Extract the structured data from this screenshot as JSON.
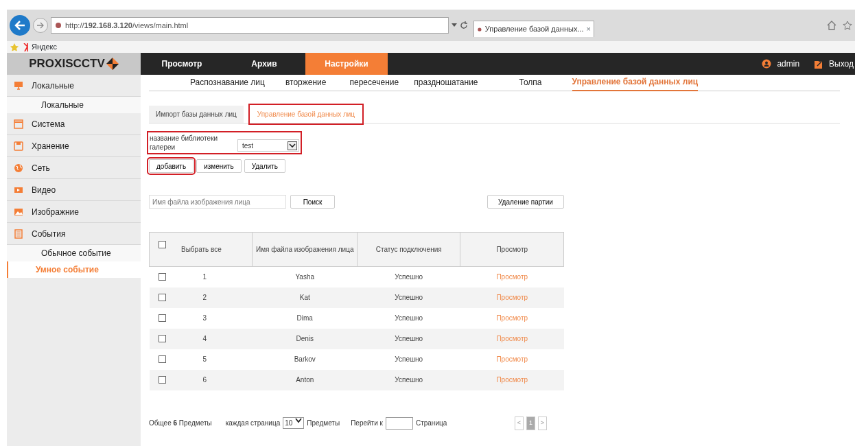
{
  "browser": {
    "url": "http://**192.168.3.120**/views/main.html",
    "tab_title": "Управление базой данных...",
    "tab_close": "×",
    "favorites": [
      "Яндекс"
    ]
  },
  "header": {
    "logo": "PROXISCCTV",
    "nav": [
      {
        "label": "Просмотр",
        "selected": false
      },
      {
        "label": "Архив",
        "selected": false
      },
      {
        "label": "Настройки",
        "selected": true
      }
    ],
    "user": "admin",
    "logout": "Выход"
  },
  "sidebar": {
    "items": [
      {
        "label": "Локальные",
        "children": [
          {
            "label": "Локальные",
            "selected": false
          }
        ]
      },
      {
        "label": "Система"
      },
      {
        "label": "Хранение"
      },
      {
        "label": "Сеть"
      },
      {
        "label": "Видео"
      },
      {
        "label": "Изображние"
      },
      {
        "label": "События",
        "children": [
          {
            "label": "Обычное событие",
            "selected": false
          },
          {
            "label": "Умное событие",
            "selected": true
          }
        ]
      }
    ]
  },
  "subtabs": [
    {
      "label": "Распознавание лиц",
      "selected": false
    },
    {
      "label": "вторжение",
      "selected": false
    },
    {
      "label": "пересечение",
      "selected": false
    },
    {
      "label": "праздношатание",
      "selected": false
    },
    {
      "label": "Толпа",
      "selected": false
    },
    {
      "label": "Управление базой данных лиц",
      "selected": true
    }
  ],
  "inner_tabs": [
    {
      "label": "Импорт базы данных лиц",
      "selected": false,
      "highlighted": false
    },
    {
      "label": "Управление базой данных лиц",
      "selected": true,
      "highlighted": true
    }
  ],
  "gallery": {
    "label": "название библиотеки галереи",
    "value": "test",
    "highlighted": true
  },
  "actions": [
    {
      "label": "добавить",
      "highlighted": true
    },
    {
      "label": "изменить",
      "highlighted": false
    },
    {
      "label": "Удалить",
      "highlighted": false
    }
  ],
  "search": {
    "placeholder": "Имя файла изображения лица",
    "button": "Поиск",
    "batch_delete": "Удаление партии"
  },
  "table": {
    "select_all": {
      "label": "Выбрать все",
      "checked": false
    },
    "columns": [
      "Имя файла изображения лица",
      "Статус подключения",
      "Просмотр"
    ],
    "rows": [
      {
        "checked": false,
        "number": "1",
        "name": "Yasha",
        "status": "Успешно",
        "view": "Просмотр"
      },
      {
        "checked": false,
        "number": "2",
        "name": "Kat",
        "status": "Успешно",
        "view": "Просмотр"
      },
      {
        "checked": false,
        "number": "3",
        "name": "Dima",
        "status": "Успешно",
        "view": "Просмотр"
      },
      {
        "checked": false,
        "number": "4",
        "name": "Denis",
        "status": "Успешно",
        "view": "Просмотр"
      },
      {
        "checked": false,
        "number": "5",
        "name": "Barkov",
        "status": "Успешно",
        "view": "Просмотр"
      },
      {
        "checked": false,
        "number": "6",
        "name": "Anton",
        "status": "Успешно",
        "view": "Просмотр"
      }
    ]
  },
  "pagination": {
    "total": "Общее **6** Предметы",
    "per_page_label": "каждая страница",
    "per_page": "10",
    "per_page_unit": "Предметы",
    "goto_label": "Перейти к",
    "goto_unit": "Страница",
    "pages": [
      {
        "label": "<",
        "selected": false
      },
      {
        "label": "1",
        "selected": true
      },
      {
        "label": ">",
        "selected": false
      }
    ]
  }
}
